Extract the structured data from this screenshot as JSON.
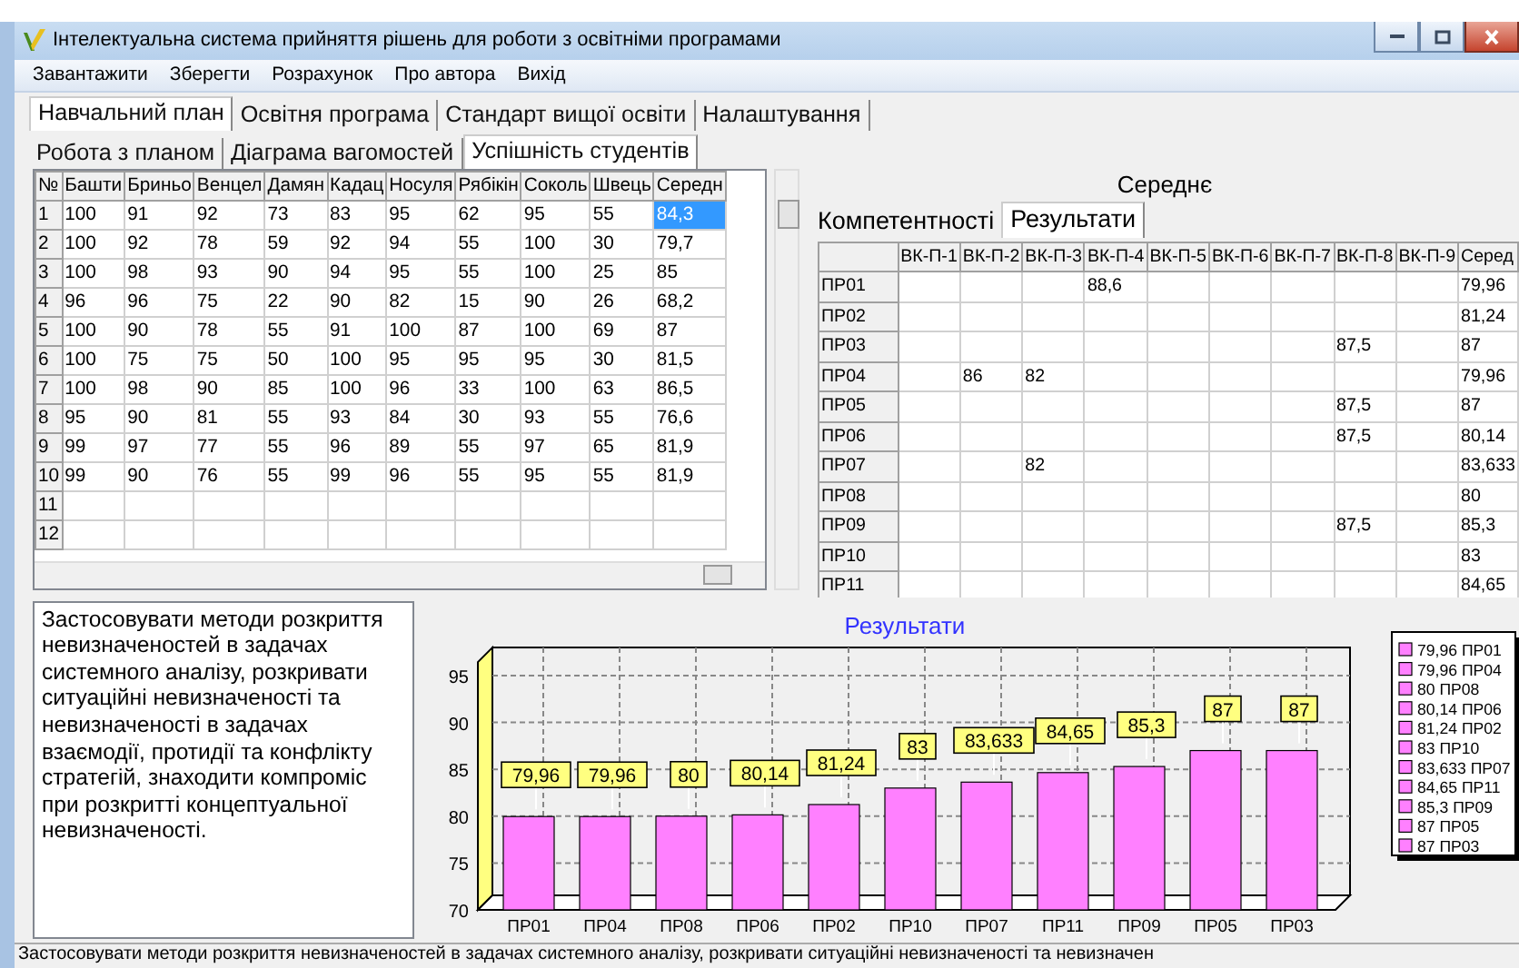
{
  "window": {
    "title": "Інтелектуальна система прийняття рішень для роботи з освітніми програмами"
  },
  "menu": [
    "Завантажити",
    "Зберегти",
    "Розрахунок",
    "Про автора",
    "Вихід"
  ],
  "main_tabs": [
    {
      "label": "Навчальний план",
      "selected": true
    },
    {
      "label": "Освітня програма",
      "selected": false
    },
    {
      "label": "Стандарт вищої освіти",
      "selected": false
    },
    {
      "label": "Налаштування",
      "selected": false
    }
  ],
  "sub_tabs": [
    {
      "label": "Робота з планом",
      "selected": false
    },
    {
      "label": "Діаграма вагомостей",
      "selected": false
    },
    {
      "label": "Успішність студентів",
      "selected": true
    }
  ],
  "student_grid": {
    "columns": [
      "№",
      "Башти",
      "Бриньо",
      "Венцел",
      "Дамян",
      "Кадац",
      "Носуля",
      "Рябікін",
      "Соколь",
      "Швець",
      "Середн"
    ],
    "rows": [
      {
        "cells": [
          "1",
          "100",
          "91",
          "92",
          "73",
          "83",
          "95",
          "62",
          "95",
          "55",
          "84,3"
        ],
        "selected": true
      },
      {
        "cells": [
          "2",
          "100",
          "92",
          "78",
          "59",
          "92",
          "94",
          "55",
          "100",
          "30",
          "79,7"
        ],
        "selected": false
      },
      {
        "cells": [
          "3",
          "100",
          "98",
          "93",
          "90",
          "94",
          "95",
          "55",
          "100",
          "25",
          "85"
        ],
        "selected": false
      },
      {
        "cells": [
          "4",
          "96",
          "96",
          "75",
          "22",
          "90",
          "82",
          "15",
          "90",
          "26",
          "68,2"
        ],
        "selected": false
      },
      {
        "cells": [
          "5",
          "100",
          "90",
          "78",
          "55",
          "91",
          "100",
          "87",
          "100",
          "69",
          "87"
        ],
        "selected": false
      },
      {
        "cells": [
          "6",
          "100",
          "75",
          "75",
          "50",
          "100",
          "95",
          "95",
          "95",
          "30",
          "81,5"
        ],
        "selected": false
      },
      {
        "cells": [
          "7",
          "100",
          "98",
          "90",
          "85",
          "100",
          "96",
          "33",
          "100",
          "63",
          "86,5"
        ],
        "selected": false
      },
      {
        "cells": [
          "8",
          "95",
          "90",
          "81",
          "55",
          "93",
          "84",
          "30",
          "93",
          "55",
          "76,6"
        ],
        "selected": false
      },
      {
        "cells": [
          "9",
          "99",
          "97",
          "77",
          "55",
          "96",
          "89",
          "55",
          "97",
          "65",
          "81,9"
        ],
        "selected": false
      },
      {
        "cells": [
          "10",
          "99",
          "90",
          "76",
          "55",
          "99",
          "96",
          "55",
          "95",
          "55",
          "81,9"
        ],
        "selected": false
      },
      {
        "cells": [
          "11",
          null,
          null,
          null,
          null,
          null,
          null,
          null,
          null,
          null,
          null
        ],
        "selected": false
      },
      {
        "cells": [
          "12",
          null,
          null,
          null,
          null,
          null,
          null,
          null,
          null,
          null,
          null
        ],
        "selected": false
      }
    ]
  },
  "results_panel": {
    "title": "Середнє",
    "tabs": [
      {
        "label": "Компетентності",
        "selected": false
      },
      {
        "label": "Результати",
        "selected": true
      }
    ],
    "grid": {
      "columns": [
        "ВК-П-1",
        "ВК-П-2",
        "ВК-П-3",
        "ВК-П-4",
        "ВК-П-5",
        "ВК-П-6",
        "ВК-П-7",
        "ВК-П-8",
        "ВК-П-9",
        "Серед"
      ],
      "rows": [
        {
          "label": "ПР01",
          "cells": [
            null,
            null,
            null,
            "88,6",
            null,
            null,
            null,
            null,
            null,
            "79,96"
          ]
        },
        {
          "label": "ПР02",
          "cells": [
            null,
            null,
            null,
            null,
            null,
            null,
            null,
            null,
            null,
            "81,24"
          ]
        },
        {
          "label": "ПР03",
          "cells": [
            null,
            null,
            null,
            null,
            null,
            null,
            null,
            "87,5",
            null,
            "87"
          ]
        },
        {
          "label": "ПР04",
          "cells": [
            null,
            "86",
            "82",
            null,
            null,
            null,
            null,
            null,
            null,
            "79,96"
          ]
        },
        {
          "label": "ПР05",
          "cells": [
            null,
            null,
            null,
            null,
            null,
            null,
            null,
            "87,5",
            null,
            "87"
          ]
        },
        {
          "label": "ПР06",
          "cells": [
            null,
            null,
            null,
            null,
            null,
            null,
            null,
            "87,5",
            null,
            "80,14"
          ]
        },
        {
          "label": "ПР07",
          "cells": [
            null,
            null,
            "82",
            null,
            null,
            null,
            null,
            null,
            null,
            "83,633"
          ]
        },
        {
          "label": "ПР08",
          "cells": [
            null,
            null,
            null,
            null,
            null,
            null,
            null,
            null,
            null,
            "80"
          ]
        },
        {
          "label": "ПР09",
          "cells": [
            null,
            null,
            null,
            null,
            null,
            null,
            null,
            "87,5",
            null,
            "85,3"
          ]
        },
        {
          "label": "ПР10",
          "cells": [
            null,
            null,
            null,
            null,
            null,
            null,
            null,
            null,
            null,
            "83"
          ]
        },
        {
          "label": "ПР11",
          "cells": [
            null,
            null,
            null,
            null,
            null,
            null,
            null,
            null,
            null,
            "84,65"
          ]
        }
      ]
    }
  },
  "memo": "Застосовувати методи розкриття невизначеностей в задачах системного аналізу, розкривати ситуаційні невизначеності та невизначеності в задачах взаємодії, протидії та конфлікту стратегій, знаходити компроміс при розкритті концептуальної невизначеності.",
  "chart": {
    "legend": [
      "79,96 ПР01",
      "79,96 ПР04",
      "80 ПР08",
      "80,14 ПР06",
      "81,24 ПР02",
      "83 ПР10",
      "83,633 ПР07",
      "84,65 ПР11",
      "85,3 ПР09",
      "87 ПР05",
      "87 ПР03"
    ],
    "chart_data": {
      "type": "bar",
      "title": "Результати",
      "categories": [
        "ПР01",
        "ПР04",
        "ПР08",
        "ПР06",
        "ПР02",
        "ПР10",
        "ПР07",
        "ПР11",
        "ПР09",
        "ПР05",
        "ПР03"
      ],
      "series": [
        {
          "color": "#ff80ff",
          "values": [
            79.96,
            79.96,
            80,
            80.14,
            81.24,
            83,
            83.633,
            84.65,
            85.3,
            87,
            87
          ]
        }
      ],
      "value_labels": [
        "79,96",
        "79,96",
        "80",
        "80,14",
        "81,24",
        "83",
        "83,633",
        "84,65",
        "85,3",
        "87",
        "87"
      ],
      "ylim": [
        70,
        98
      ],
      "yticks": [
        70,
        75,
        80,
        85,
        90,
        95
      ],
      "grid": true
    }
  },
  "status_bar": "Застосовувати методи розкриття невизначеностей в задачах системного аналізу, розкривати ситуаційні невизначеності та невизначен"
}
